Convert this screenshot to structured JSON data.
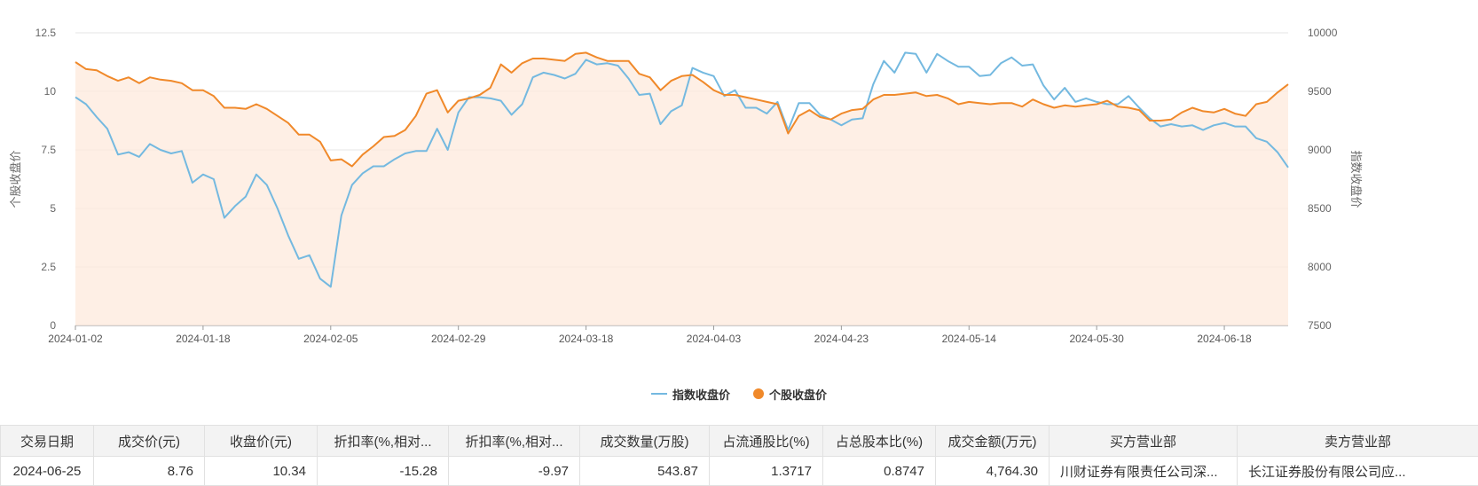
{
  "chart_data": {
    "type": "line",
    "y_left_label": "个股收盘价",
    "y_right_label": "指数收盘价",
    "y_left_ticks": [
      "0",
      "2.5",
      "5",
      "7.5",
      "10",
      "12.5"
    ],
    "y_right_ticks": [
      "7500",
      "8000",
      "8500",
      "9000",
      "9500",
      "10000"
    ],
    "y_left_range": [
      0,
      12.5
    ],
    "y_right_range": [
      7500,
      10000
    ],
    "x_tick_labels": [
      "2024-01-02",
      "2024-01-18",
      "2024-02-05",
      "2024-02-29",
      "2024-03-18",
      "2024-04-03",
      "2024-04-23",
      "2024-05-14",
      "2024-05-30",
      "2024-06-18"
    ],
    "x_tick_indices": [
      0,
      12,
      24,
      36,
      48,
      60,
      72,
      84,
      96,
      108
    ],
    "legend_placement": "bottom-center",
    "grid": true,
    "series": [
      {
        "name": "指数收盘价",
        "axis": "right",
        "color": "#74b9e0",
        "values": [
          9450,
          9390,
          9280,
          9180,
          8960,
          8980,
          8940,
          9050,
          9000,
          8970,
          8990,
          8720,
          8790,
          8750,
          8420,
          8520,
          8600,
          8790,
          8700,
          8500,
          8270,
          8070,
          8100,
          7900,
          7830,
          8440,
          8700,
          8800,
          8860,
          8860,
          8920,
          8970,
          8990,
          8990,
          9180,
          9000,
          9320,
          9450,
          9450,
          9440,
          9420,
          9300,
          9390,
          9620,
          9660,
          9640,
          9610,
          9650,
          9770,
          9730,
          9740,
          9720,
          9610,
          9470,
          9480,
          9220,
          9330,
          9380,
          9700,
          9660,
          9630,
          9460,
          9510,
          9360,
          9360,
          9310,
          9410,
          9170,
          9400,
          9400,
          9300,
          9260,
          9210,
          9260,
          9270,
          9560,
          9760,
          9660,
          9830,
          9820,
          9660,
          9820,
          9760,
          9710,
          9710,
          9630,
          9640,
          9740,
          9790,
          9720,
          9730,
          9550,
          9430,
          9530,
          9410,
          9440,
          9410,
          9390,
          9390,
          9460,
          9360,
          9270,
          9200,
          9220,
          9200,
          9210,
          9170,
          9210,
          9230,
          9200,
          9200,
          9100,
          9070,
          8980,
          8850
        ]
      },
      {
        "name": "个股收盘价",
        "axis": "left",
        "color": "#f0892a",
        "values": [
          11.25,
          10.95,
          10.9,
          10.65,
          10.45,
          10.6,
          10.35,
          10.6,
          10.5,
          10.45,
          10.35,
          10.05,
          10.05,
          9.8,
          9.3,
          9.3,
          9.25,
          9.45,
          9.25,
          8.95,
          8.65,
          8.15,
          8.15,
          7.85,
          7.05,
          7.1,
          6.8,
          7.3,
          7.65,
          8.05,
          8.1,
          8.35,
          8.95,
          9.9,
          10.05,
          9.1,
          9.6,
          9.7,
          9.85,
          10.15,
          11.15,
          10.8,
          11.2,
          11.4,
          11.4,
          11.35,
          11.3,
          11.6,
          11.65,
          11.45,
          11.3,
          11.3,
          11.3,
          10.75,
          10.6,
          10.05,
          10.45,
          10.65,
          10.7,
          10.4,
          10.05,
          9.85,
          9.85,
          9.75,
          9.65,
          9.55,
          9.45,
          8.2,
          8.95,
          9.2,
          8.9,
          8.8,
          9.05,
          9.2,
          9.25,
          9.65,
          9.85,
          9.85,
          9.9,
          9.95,
          9.8,
          9.85,
          9.7,
          9.45,
          9.55,
          9.5,
          9.45,
          9.5,
          9.5,
          9.35,
          9.65,
          9.45,
          9.3,
          9.4,
          9.35,
          9.4,
          9.45,
          9.6,
          9.35,
          9.3,
          9.2,
          8.75,
          8.75,
          8.8,
          9.1,
          9.3,
          9.15,
          9.1,
          9.25,
          9.05,
          8.95,
          9.45,
          9.55,
          9.95,
          10.3
        ]
      }
    ]
  },
  "table": {
    "headers": [
      "交易日期",
      "成交价(元)",
      "收盘价(元)",
      "折扣率(%,相对...",
      "折扣率(%,相对...",
      "成交数量(万股)",
      "占流通股比(%)",
      "占总股本比(%)",
      "成交金额(万元)",
      "买方营业部",
      "卖方营业部"
    ],
    "rows": [
      [
        "2024-06-25",
        "8.76",
        "10.34",
        "-15.28",
        "-9.97",
        "543.87",
        "1.3717",
        "0.8747",
        "4,764.30",
        "川财证券有限责任公司深...",
        "长江证券股份有限公司应..."
      ]
    ]
  }
}
